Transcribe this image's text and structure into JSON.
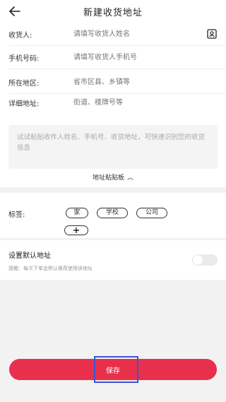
{
  "header": {
    "title": "新建收货地址"
  },
  "form": {
    "consignee": {
      "label": "收货人:",
      "placeholder": "请填写收货人姓名"
    },
    "phone": {
      "label": "手机号码:",
      "placeholder": "请填写收货人手机号"
    },
    "region": {
      "label": "所在地区:",
      "placeholder": "省市区县、乡镇等"
    },
    "detail": {
      "label": "详细地址:",
      "placeholder": "街道、楼牌号等"
    },
    "paste_hint": "试试粘贴收件人姓名、手机号、收货地址，可快速识别您的收货信息",
    "recognize_label": "地址粘贴板",
    "recognize_chevron": "︿"
  },
  "tags": {
    "label": "标签:",
    "options": [
      "家",
      "学校",
      "公司"
    ]
  },
  "default_address": {
    "label": "设置默认地址",
    "hint": "提醒：每次下单会默认推荐使用该地址"
  },
  "footer": {
    "save_label": "保存"
  },
  "colors": {
    "accent": "#e8304c",
    "focus": "#3a55d6"
  }
}
